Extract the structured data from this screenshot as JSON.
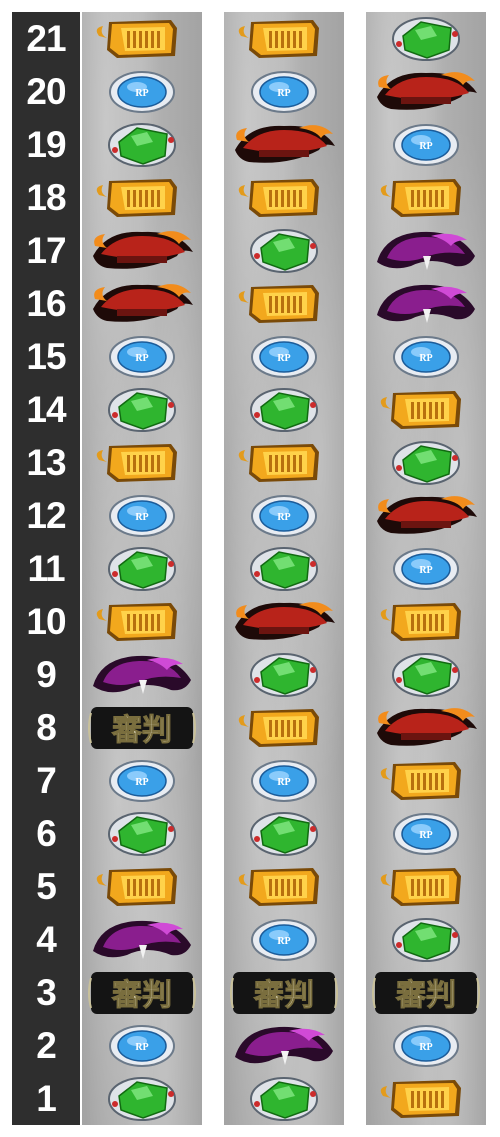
{
  "rows": [
    "21",
    "20",
    "19",
    "18",
    "17",
    "16",
    "15",
    "14",
    "13",
    "12",
    "11",
    "10",
    "9",
    "8",
    "7",
    "6",
    "5",
    "4",
    "3",
    "2",
    "1"
  ],
  "symbol_legend": {
    "gold": "gold-temple-symbol",
    "blue": "blue-rp-gem-symbol",
    "green": "green-gem-symbol",
    "red": "red-phoenix-symbol",
    "purple": "purple-dragon-symbol",
    "hanko": "hanko-judgment-symbol"
  },
  "hanko_text": "審判",
  "rp_text": "RP",
  "colors": {
    "number_column": "#2e2e2e",
    "reel_bg": "#a8a8a8",
    "gold": "#f2a81d",
    "blue": "#3aa0e8",
    "green": "#2fb52f",
    "red": "#b8231a",
    "purple": "#8a1e8e"
  },
  "reels": [
    [
      "gold",
      "blue",
      "green",
      "gold",
      "red",
      "red",
      "blue",
      "green",
      "gold",
      "blue",
      "green",
      "gold",
      "purple",
      "hanko",
      "blue",
      "green",
      "gold",
      "purple",
      "hanko",
      "blue",
      "green"
    ],
    [
      "gold",
      "blue",
      "red",
      "gold",
      "green",
      "gold",
      "blue",
      "green",
      "gold",
      "blue",
      "green",
      "red",
      "green",
      "gold",
      "blue",
      "green",
      "gold",
      "blue",
      "hanko",
      "purple",
      "green"
    ],
    [
      "green",
      "red",
      "blue",
      "gold",
      "purple",
      "purple",
      "blue",
      "gold",
      "green",
      "red",
      "blue",
      "gold",
      "green",
      "red",
      "gold",
      "blue",
      "gold",
      "green",
      "hanko",
      "blue",
      "gold"
    ]
  ]
}
